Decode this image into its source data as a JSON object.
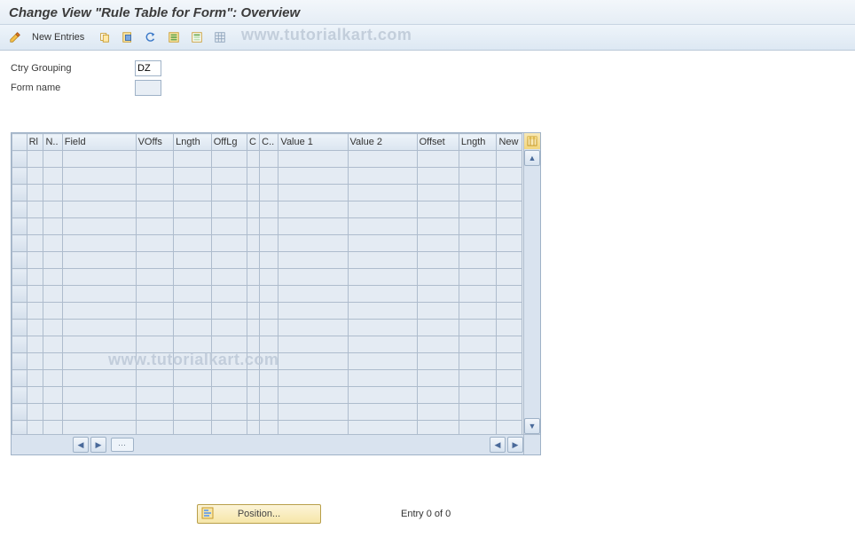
{
  "title": "Change View \"Rule Table for Form\": Overview",
  "watermark": "www.tutorialkart.com",
  "toolbar": {
    "new_entries_label": "New Entries"
  },
  "form": {
    "ctry_grouping_label": "Ctry Grouping",
    "ctry_grouping_value": "DZ",
    "form_name_label": "Form name",
    "form_name_value": ""
  },
  "table": {
    "columns": [
      "Rl",
      "N..",
      "Field",
      "VOffs",
      "Lngth",
      "OffLg",
      "C",
      "C..",
      "Value 1",
      "Value 2",
      "Offset",
      "Lngth",
      "New"
    ],
    "row_count": 18,
    "entry_status": "Entry 0 of 0"
  },
  "footer": {
    "position_label": "Position..."
  }
}
